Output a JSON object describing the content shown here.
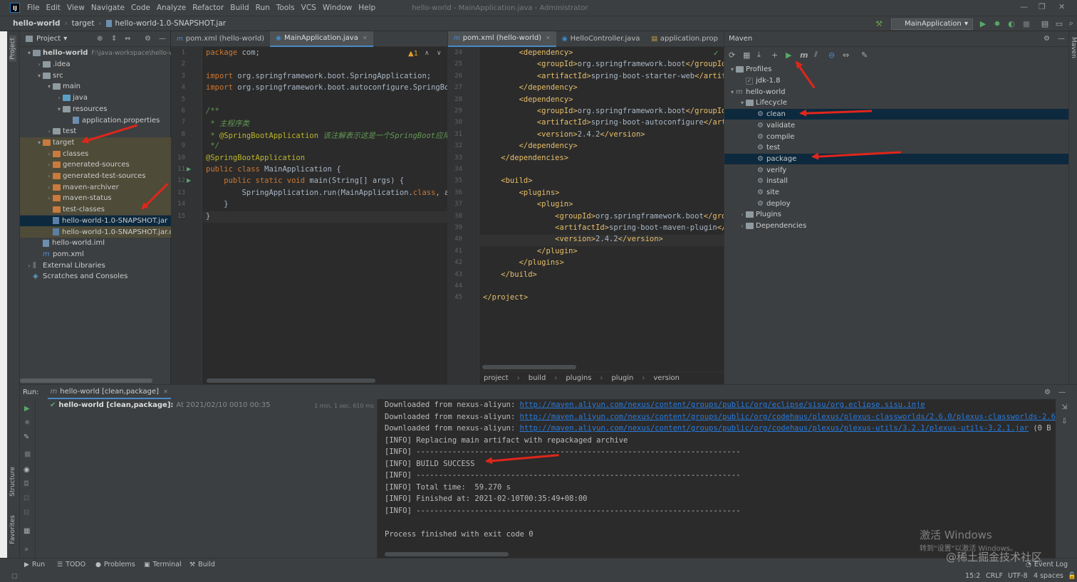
{
  "menubar": {
    "logo": "IJ",
    "items": [
      "File",
      "Edit",
      "View",
      "Navigate",
      "Code",
      "Analyze",
      "Refactor",
      "Build",
      "Run",
      "Tools",
      "VCS",
      "Window",
      "Help"
    ],
    "window_title": "hello-world - MainApplication.java - Administrator"
  },
  "navbar": {
    "crumbs": [
      "hello-world",
      "target",
      "hello-world-1.0-SNAPSHOT.jar"
    ],
    "run_config": "MainApplication"
  },
  "side_tabs": {
    "project": "Project",
    "structure": "Structure",
    "favorites": "Favorites",
    "maven": "Maven"
  },
  "project": {
    "header": "Project",
    "tree": [
      {
        "label": "hello-world",
        "sub": "F:\\java-workspace\\hello-w",
        "depth": 0,
        "arrow": "v",
        "icon": "blue",
        "bold": true
      },
      {
        "label": ".idea",
        "depth": 1,
        "arrow": ">",
        "icon": "grey"
      },
      {
        "label": "src",
        "depth": 1,
        "arrow": "v",
        "icon": "grey"
      },
      {
        "label": "main",
        "depth": 2,
        "arrow": "v",
        "icon": "grey"
      },
      {
        "label": "java",
        "depth": 3,
        "arrow": ">",
        "icon": "teal"
      },
      {
        "label": "resources",
        "depth": 3,
        "arrow": "v",
        "icon": "grey"
      },
      {
        "label": "application.properties",
        "depth": 4,
        "arrow": "",
        "icon": "file"
      },
      {
        "label": "test",
        "depth": 2,
        "arrow": ">",
        "icon": "grey"
      },
      {
        "label": "target",
        "depth": 1,
        "arrow": "v",
        "icon": "orange",
        "hl": true
      },
      {
        "label": "classes",
        "depth": 2,
        "arrow": ">",
        "icon": "orange",
        "hl": true
      },
      {
        "label": "generated-sources",
        "depth": 2,
        "arrow": ">",
        "icon": "orange",
        "hl": true
      },
      {
        "label": "generated-test-sources",
        "depth": 2,
        "arrow": ">",
        "icon": "orange",
        "hl": true
      },
      {
        "label": "maven-archiver",
        "depth": 2,
        "arrow": ">",
        "icon": "orange",
        "hl": true
      },
      {
        "label": "maven-status",
        "depth": 2,
        "arrow": ">",
        "icon": "orange",
        "hl": true
      },
      {
        "label": "test-classes",
        "depth": 2,
        "arrow": "",
        "icon": "orange",
        "hl": true
      },
      {
        "label": "hello-world-1.0-SNAPSHOT.jar",
        "depth": 2,
        "arrow": "",
        "icon": "jar",
        "sel": true
      },
      {
        "label": "hello-world-1.0-SNAPSHOT.jar.or",
        "depth": 2,
        "arrow": "",
        "icon": "jar",
        "hl": true
      },
      {
        "label": "hello-world.iml",
        "depth": 1,
        "arrow": "",
        "icon": "file"
      },
      {
        "label": "pom.xml",
        "depth": 1,
        "arrow": "",
        "icon": "m"
      },
      {
        "label": "External Libraries",
        "depth": 0,
        "arrow": ">",
        "icon": "lib"
      },
      {
        "label": "Scratches and Consoles",
        "depth": 0,
        "arrow": "",
        "icon": "scratch"
      }
    ]
  },
  "editor1": {
    "tabs": [
      {
        "label": "pom.xml (hello-world)",
        "icon": "m",
        "active": false
      },
      {
        "label": "MainApplication.java",
        "icon": "c",
        "active": true
      }
    ],
    "warnings": "1",
    "line_numbers": [
      "1",
      "2",
      "3",
      "4",
      "5",
      "6",
      "7",
      "8",
      "9",
      "10",
      "11",
      "12",
      "13",
      "14",
      "15"
    ],
    "lines": [
      [
        {
          "t": "package",
          "c": "kw"
        },
        {
          "t": " com;"
        }
      ],
      [],
      [
        {
          "t": "import",
          "c": "kw"
        },
        {
          "t": " org.springframework.boot.SpringApplication;"
        }
      ],
      [
        {
          "t": "import",
          "c": "kw"
        },
        {
          "t": " org.springframework.boot.autoconfigure.SpringBo"
        }
      ],
      [],
      [
        {
          "t": "/**",
          "c": "cmt"
        }
      ],
      [
        {
          "t": " * 主程序类",
          "c": "cmt"
        }
      ],
      [
        {
          "t": " * ",
          "c": "cmt"
        },
        {
          "t": "@SpringBootApplication",
          "c": "ann"
        },
        {
          "t": " 该注解表示这是一个SpringBoot应用",
          "c": "cmt"
        }
      ],
      [
        {
          "t": " */",
          "c": "cmt"
        }
      ],
      [
        {
          "t": "@SpringBootApplication",
          "c": "ann"
        }
      ],
      [
        {
          "t": "public class",
          "c": "kw"
        },
        {
          "t": " MainApplication {"
        }
      ],
      [
        {
          "t": "    public static void",
          "c": "kw"
        },
        {
          "t": " main(String[] args) {"
        }
      ],
      [
        {
          "t": "        SpringApplication.run(MainApplication."
        },
        {
          "t": "class",
          "c": "kw"
        },
        {
          "t": ", a"
        }
      ],
      [
        {
          "t": "    }"
        }
      ],
      [
        {
          "t": "}"
        }
      ]
    ]
  },
  "editor2": {
    "tabs": [
      {
        "label": "pom.xml (hello-world)",
        "icon": "m",
        "active": true
      },
      {
        "label": "HelloController.java",
        "icon": "c",
        "active": false
      },
      {
        "label": "application.prop",
        "icon": "p",
        "active": false
      }
    ],
    "line_numbers": [
      "24",
      "25",
      "26",
      "27",
      "28",
      "29",
      "30",
      "31",
      "32",
      "33",
      "34",
      "35",
      "36",
      "37",
      "38",
      "39",
      "40",
      "41",
      "42",
      "43",
      "44",
      "45"
    ],
    "lines": [
      [
        {
          "t": "        <dependency>",
          "c": "tag"
        }
      ],
      [
        {
          "t": "            <groupId>",
          "c": "tag"
        },
        {
          "t": "org.springframework.boot"
        },
        {
          "t": "</groupId",
          "c": "tag"
        }
      ],
      [
        {
          "t": "            <artifactId>",
          "c": "tag"
        },
        {
          "t": "spring-boot-starter-web"
        },
        {
          "t": "</artif",
          "c": "tag"
        }
      ],
      [
        {
          "t": "        </dependency>",
          "c": "tag"
        }
      ],
      [
        {
          "t": "        <dependency>",
          "c": "tag"
        }
      ],
      [
        {
          "t": "            <groupId>",
          "c": "tag"
        },
        {
          "t": "org.springframework.boot"
        },
        {
          "t": "</groupId",
          "c": "tag"
        }
      ],
      [
        {
          "t": "            <artifactId>",
          "c": "tag"
        },
        {
          "t": "spring-boot-autoconfigure"
        },
        {
          "t": "</art",
          "c": "tag"
        }
      ],
      [
        {
          "t": "            <version>",
          "c": "tag"
        },
        {
          "t": "2.4.2"
        },
        {
          "t": "</version>",
          "c": "tag"
        }
      ],
      [
        {
          "t": "        </dependency>",
          "c": "tag"
        }
      ],
      [
        {
          "t": "    </dependencies>",
          "c": "tag"
        }
      ],
      [],
      [
        {
          "t": "    <build>",
          "c": "tag"
        }
      ],
      [
        {
          "t": "        <plugins>",
          "c": "tag"
        }
      ],
      [
        {
          "t": "            <plugin>",
          "c": "tag"
        }
      ],
      [
        {
          "t": "                <groupId>",
          "c": "tag"
        },
        {
          "t": "org.springframework.boot"
        },
        {
          "t": "</gro",
          "c": "tag"
        }
      ],
      [
        {
          "t": "                <artifactId>",
          "c": "tag"
        },
        {
          "t": "spring-boot-maven-plugin"
        },
        {
          "t": "</",
          "c": "tag"
        }
      ],
      [
        {
          "t": "                <version>",
          "c": "tag"
        },
        {
          "t": "2.4.2"
        },
        {
          "t": "</version>",
          "c": "tag"
        }
      ],
      [
        {
          "t": "            </plugin>",
          "c": "tag"
        }
      ],
      [
        {
          "t": "        </plugins>",
          "c": "tag"
        }
      ],
      [
        {
          "t": "    </build>",
          "c": "tag"
        }
      ],
      [],
      [
        {
          "t": "</project>",
          "c": "tag"
        }
      ]
    ],
    "breadcrumb": [
      "project",
      "build",
      "plugins",
      "plugin",
      "version"
    ]
  },
  "maven": {
    "title": "Maven",
    "tree": [
      {
        "label": "Profiles",
        "depth": 0,
        "arrow": "v",
        "icon": "folder"
      },
      {
        "label": "jdk-1.8",
        "depth": 1,
        "arrow": "",
        "icon": "check"
      },
      {
        "label": "hello-world",
        "depth": 0,
        "arrow": "v",
        "icon": "m"
      },
      {
        "label": "Lifecycle",
        "depth": 1,
        "arrow": "v",
        "icon": "folder"
      },
      {
        "label": "clean",
        "depth": 2,
        "arrow": "",
        "icon": "gear",
        "sel": true
      },
      {
        "label": "validate",
        "depth": 2,
        "arrow": "",
        "icon": "gear"
      },
      {
        "label": "compile",
        "depth": 2,
        "arrow": "",
        "icon": "gear"
      },
      {
        "label": "test",
        "depth": 2,
        "arrow": "",
        "icon": "gear"
      },
      {
        "label": "package",
        "depth": 2,
        "arrow": "",
        "icon": "gear",
        "sel": true
      },
      {
        "label": "verify",
        "depth": 2,
        "arrow": "",
        "icon": "gear"
      },
      {
        "label": "install",
        "depth": 2,
        "arrow": "",
        "icon": "gear"
      },
      {
        "label": "site",
        "depth": 2,
        "arrow": "",
        "icon": "gear"
      },
      {
        "label": "deploy",
        "depth": 2,
        "arrow": "",
        "icon": "gear"
      },
      {
        "label": "Plugins",
        "depth": 1,
        "arrow": ">",
        "icon": "folder"
      },
      {
        "label": "Dependencies",
        "depth": 1,
        "arrow": ">",
        "icon": "folder"
      }
    ]
  },
  "run": {
    "label": "Run:",
    "tab": "hello-world [clean,package]",
    "entry_name": "hello-world [clean,package]:",
    "entry_time": "At 2021/02/10 0010 00:35",
    "duration": "1 min, 1 sec, 610 ms",
    "console": [
      {
        "pre": "Downloaded from nexus-aliyun: ",
        "link": "http://maven.aliyun.com/nexus/content/groups/public/org/eclipse/sisu/org.eclipse.sisu.inje",
        "post": ""
      },
      {
        "pre": "Downloaded from nexus-aliyun: ",
        "link": "http://maven.aliyun.com/nexus/content/groups/public/org/codehaus/plexus/plexus-classworlds/2.6.0/plexus-classworlds-2.6.",
        "post": ""
      },
      {
        "pre": "Downloaded from nexus-aliyun: ",
        "link": "http://maven.aliyun.com/nexus/content/groups/public/org/codehaus/plexus/plexus-utils/3.2.1/plexus-utils-3.2.1.jar",
        "post": " (0 B a"
      },
      {
        "pre": "[INFO] Replacing main artifact with repackaged archive"
      },
      {
        "pre": "[INFO] ------------------------------------------------------------------------"
      },
      {
        "pre": "[INFO] BUILD SUCCESS"
      },
      {
        "pre": "[INFO] ------------------------------------------------------------------------"
      },
      {
        "pre": "[INFO] Total time:  59.270 s"
      },
      {
        "pre": "[INFO] Finished at: 2021-02-10T00:35:49+08:00"
      },
      {
        "pre": "[INFO] ------------------------------------------------------------------------"
      },
      {
        "pre": ""
      },
      {
        "pre": "Process finished with exit code 0"
      }
    ]
  },
  "statusbar": {
    "tools": [
      "Run",
      "TODO",
      "Problems",
      "Terminal",
      "Build"
    ],
    "event_log": "Event Log",
    "position": "15:2",
    "line_sep": "CRLF",
    "encoding": "UTF-8",
    "indent": "4 spaces"
  },
  "watermark": {
    "activate": "激活 Windows",
    "activate_sub": "转到\"设置\"以激活 Windows。",
    "site": "@稀土掘金技术社区"
  },
  "colors": {
    "arrow": "#e0261b",
    "selection": "#0d293e",
    "highlight": "#4e4b38",
    "link": "#287bde"
  }
}
